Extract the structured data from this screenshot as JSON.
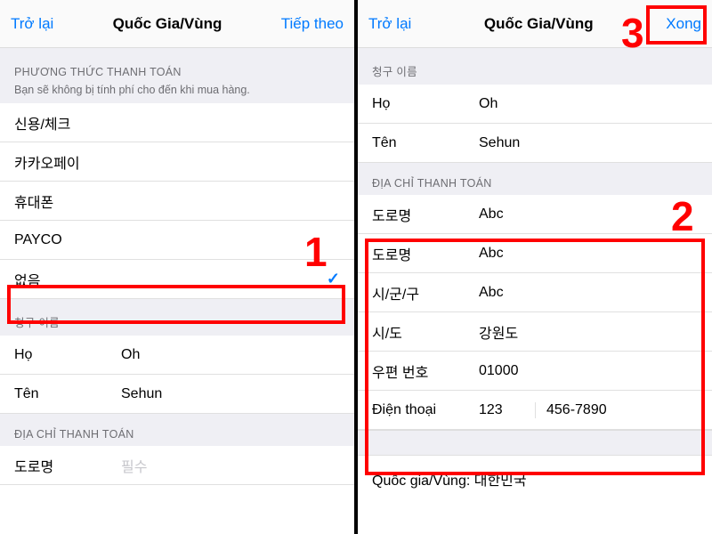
{
  "left": {
    "header": {
      "back": "Trở lại",
      "title": "Quốc Gia/Vùng",
      "action": "Tiếp theo"
    },
    "payment_section_title": "PHƯƠNG THỨC THANH TOÁN",
    "payment_section_sub": "Bạn sẽ không bị tính phí cho đến khi mua hàng.",
    "payment_options": [
      {
        "label": "신용/체크",
        "selected": false
      },
      {
        "label": "카카오페이",
        "selected": false
      },
      {
        "label": "휴대폰",
        "selected": false
      },
      {
        "label": "PAYCO",
        "selected": false
      },
      {
        "label": "없음",
        "selected": true
      }
    ],
    "billing_name_title": "청구 이름",
    "billing_name": [
      {
        "label": "Họ",
        "value": "Oh"
      },
      {
        "label": "Tên",
        "value": "Sehun"
      }
    ],
    "billing_addr_title": "ĐỊA CHỈ THANH TOÁN",
    "addr_row": {
      "label": "도로명",
      "placeholder": "필수"
    }
  },
  "right": {
    "header": {
      "back": "Trở lại",
      "title": "Quốc Gia/Vùng",
      "action": "Xong"
    },
    "billing_name_title": "청구 이름",
    "billing_name": [
      {
        "label": "Họ",
        "value": "Oh"
      },
      {
        "label": "Tên",
        "value": "Sehun"
      }
    ],
    "billing_addr_title": "ĐỊA CHỈ THANH TOÁN",
    "addr_rows": [
      {
        "label": "도로명",
        "value": "Abc"
      },
      {
        "label": "도로명",
        "value": "Abc"
      },
      {
        "label": "시/군/구",
        "value": "Abc"
      },
      {
        "label": "시/도",
        "value": "강원도"
      },
      {
        "label": "우편 번호",
        "value": "01000"
      }
    ],
    "phone": {
      "label": "Điện thoại",
      "part1": "123",
      "part2": "456-7890"
    },
    "country_label": "Quốc gia/Vùng: 대한민국"
  },
  "annotations": {
    "n1": "1",
    "n2": "2",
    "n3": "3"
  }
}
